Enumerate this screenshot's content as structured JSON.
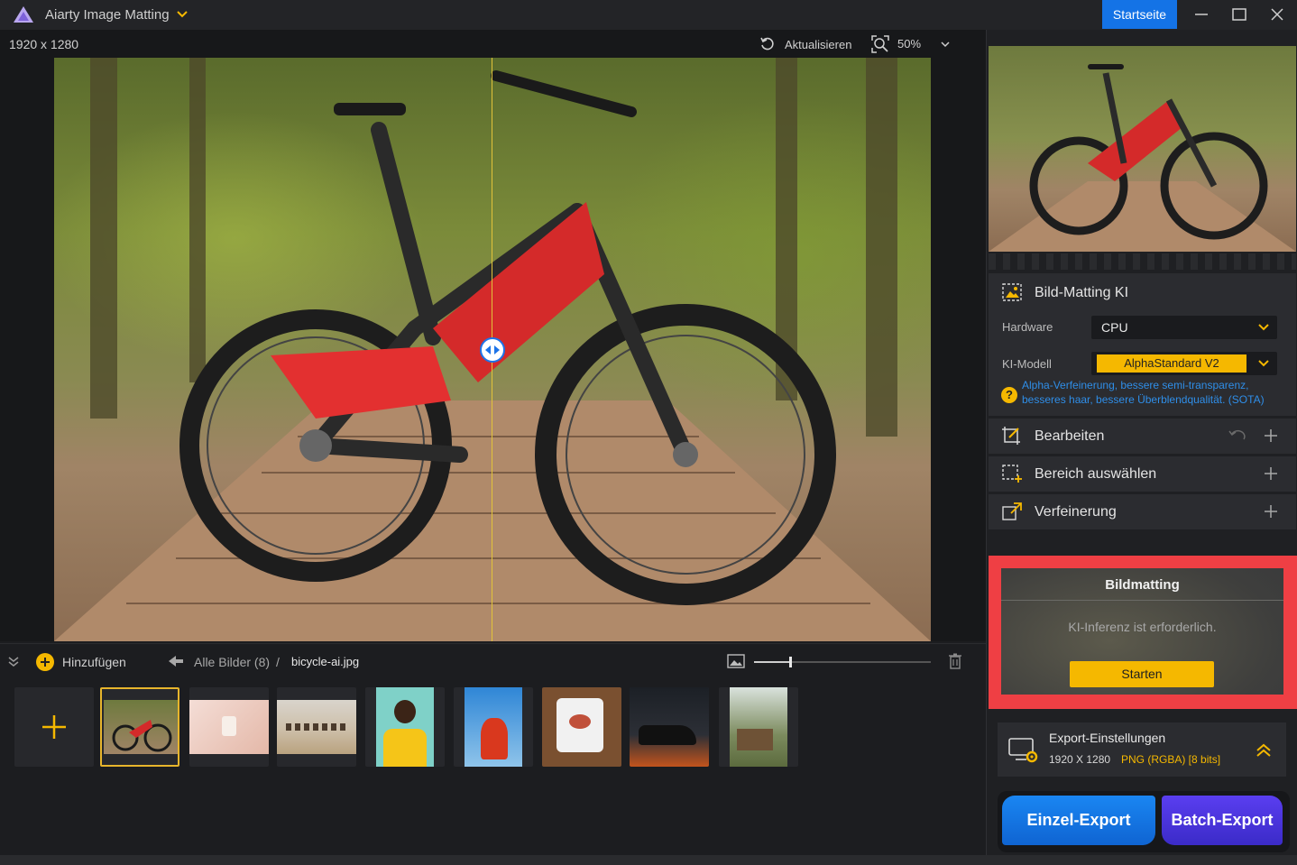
{
  "window": {
    "app_title": "Aiarty Image Matting",
    "home_button": "Startseite"
  },
  "canvas": {
    "image_dimensions": "1920 x 1280",
    "refresh_label": "Aktualisieren",
    "zoom": "50%"
  },
  "filmstrip": {
    "add_label": "Hinzufügen",
    "all_images_label": "Alle Bilder (8)",
    "separator": "/",
    "current_file": "bicycle-ai.jpg",
    "thumbnail_size_level": 0.2,
    "thumbnails": [
      {
        "subject": "mountain bike on boardwalk",
        "selected": true
      },
      {
        "subject": "perfume bottle"
      },
      {
        "subject": "camels in desert"
      },
      {
        "subject": "woman in yellow sweater"
      },
      {
        "subject": "woman in red dress"
      },
      {
        "subject": "printed t-shirt"
      },
      {
        "subject": "sneaker"
      },
      {
        "subject": "wooden cabin"
      }
    ]
  },
  "panel": {
    "ai_section": {
      "title": "Bild-Matting KI",
      "hardware_label": "Hardware",
      "hardware_value": "CPU",
      "model_label": "KI-Modell",
      "model_value": "AlphaStandard  V2",
      "model_description": "Alpha-Verfeinerung, bessere semi-transparenz, besseres haar, bessere Überblendqualität. (SOTA)"
    },
    "edit_section": {
      "title": "Bearbeiten"
    },
    "select_section": {
      "title": "Bereich auswählen"
    },
    "refine_section": {
      "title": "Verfeinerung"
    },
    "matting": {
      "title": "Bildmatting",
      "message": "KI-Inferenz ist erforderlich.",
      "start_button": "Starten"
    },
    "export_settings": {
      "title": "Export-Einstellungen",
      "dimensions": "1920 X 1280",
      "format": "PNG (RGBA) [8 bits]"
    },
    "single_export": "Einzel-Export",
    "batch_export": "Batch-Export"
  },
  "colors": {
    "accent_yellow": "#f5b800",
    "accent_blue": "#1473e6",
    "highlight_red": "#ef3f44",
    "batch_purple": "#4a33dc"
  }
}
